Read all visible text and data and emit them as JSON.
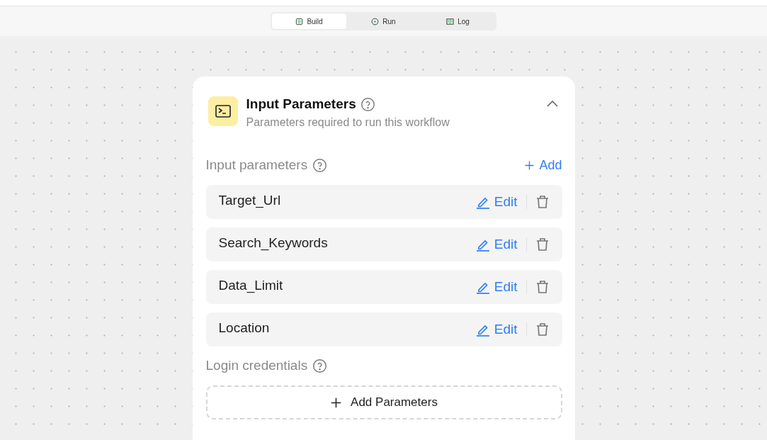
{
  "tabs": [
    {
      "label": "Build",
      "selected": true
    },
    {
      "label": "Run",
      "selected": false
    },
    {
      "label": "Log",
      "selected": false
    }
  ],
  "card": {
    "title": "Input Parameters",
    "subtitle": "Parameters required to run this workflow",
    "expanded": true,
    "input_section": {
      "label": "Input parameters",
      "add_label": "Add"
    },
    "parameters": [
      {
        "name": "Target_Url",
        "edit_label": "Edit"
      },
      {
        "name": "Search_Keywords",
        "edit_label": "Edit"
      },
      {
        "name": "Data_Limit",
        "edit_label": "Edit"
      },
      {
        "name": "Location",
        "edit_label": "Edit"
      }
    ],
    "login_section": {
      "label": "Login credentials",
      "add_label": "Add Parameters"
    }
  }
}
